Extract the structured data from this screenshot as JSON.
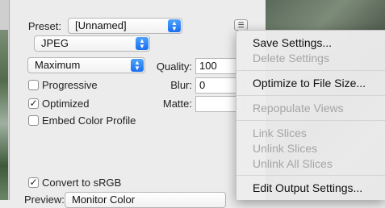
{
  "preset": {
    "label": "Preset:",
    "value": "[Unnamed]"
  },
  "format": {
    "value": "JPEG"
  },
  "quality_preset": {
    "value": "Maximum"
  },
  "quality": {
    "label": "Quality:",
    "value": "100"
  },
  "blur": {
    "label": "Blur:",
    "value": "0"
  },
  "matte": {
    "label": "Matte:",
    "value": ""
  },
  "options": {
    "progressive": {
      "label": "Progressive",
      "checked": false
    },
    "optimized": {
      "label": "Optimized",
      "checked": true
    },
    "embed_profile": {
      "label": "Embed Color Profile",
      "checked": false
    },
    "convert_srgb": {
      "label": "Convert to sRGB",
      "checked": true
    }
  },
  "preview": {
    "label": "Preview:",
    "value": "Monitor Color"
  },
  "menu": {
    "items": [
      {
        "label": "Save Settings...",
        "enabled": true
      },
      {
        "label": "Delete Settings",
        "enabled": false
      },
      {
        "label": "Optimize to File Size...",
        "enabled": true
      },
      {
        "label": "Repopulate Views",
        "enabled": false
      },
      {
        "label": "Link Slices",
        "enabled": false
      },
      {
        "label": "Unlink Slices",
        "enabled": false
      },
      {
        "label": "Unlink All Slices",
        "enabled": false
      },
      {
        "label": "Edit Output Settings...",
        "enabled": true
      }
    ]
  }
}
